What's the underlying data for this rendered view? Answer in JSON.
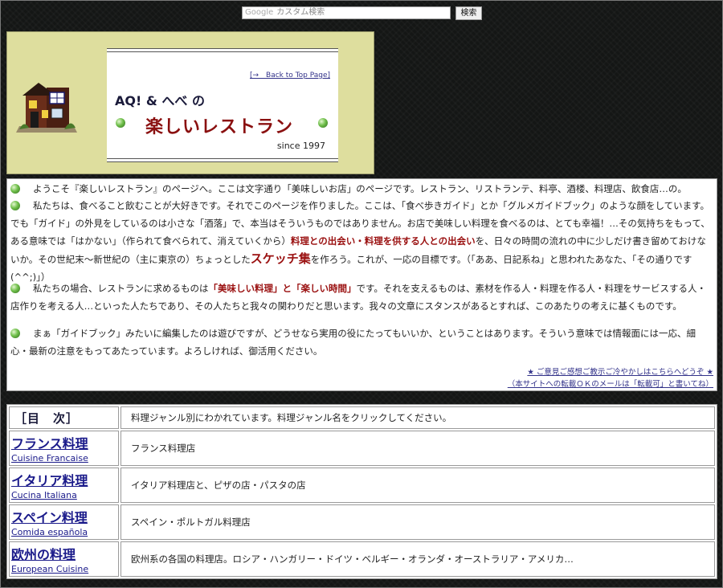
{
  "search": {
    "placeholder_brand": "Google",
    "placeholder": "カスタム検索",
    "button_label": "検索"
  },
  "header": {
    "back_link": "[→　Back to Top Page]",
    "brand": "AQ! & へべ の",
    "title": "楽しいレストラン",
    "since": "since 1997"
  },
  "intro": {
    "p1": "ようこそ『楽しいレストラン』のページへ。ここは文字通り「美味しいお店」のページです。レストラン、リストランテ、料亭、酒楼、料理店、飲食店…の。",
    "p2_a": "私たちは、食べること飲むことが大好きです。それでこのページを作りました。ここは、「食べ歩きガイド」とか「グルメガイドブック」のような顔をしています。でも「ガイド」の外見をしているのは小さな「酒落」で、本当はそういうものではありません。お店で美味しい料理を食べるのは、とても幸福！…その気持ちをもって、ある意味では「はかない」（作られて食べられて、消えていくから）",
    "p2_red": "料理との出会い・料理を供する人との出会い",
    "p2_b": "を、日々の時間の流れの中に少しだけ書き留めておけないか。その世紀末～新世紀の（主に東京の）ちょっとした",
    "p2_big": "スケッチ集",
    "p2_c": "を作ろう。これが、一応の目標です。（「ああ、日記系ね」と思われたあなた、「その通りです(^^;)」）",
    "p3_a": "私たちの場合、レストランに求めるものは",
    "p3_red": "「美味しい料理」と「楽しい時間」",
    "p3_b": "です。それを支えるものは、素材を作る人・料理を作る人・料理をサービスする人・店作りを考える人…といった人たちであり、その人たちと我々の関わりだと思います。我々の文章にスタンスがあるとすれば、このあたりの考えに基くものです。",
    "p4": "まぁ「ガイドブック」みたいに編集したのは遊びですが、どうせなら実用の役にたってもいいか、ということはあります。そういう意味では情報面には一応、細心・最新の注意をもってあたっています。よろしければ、御活用ください。",
    "contact_1": "★ ご意見ご感想ご教示ご冷やかしはこちらへどうぞ ★",
    "contact_2": "（本サイトへの転載ＯＫのメールは「転載可」と書いてね）"
  },
  "toc": {
    "header": "［目　次］",
    "header_desc": "料理ジャンル別にわかれています。料理ジャンル名をクリックしてください。",
    "rows": [
      {
        "name": "フランス料理",
        "sub": "Cuisine Francaise",
        "desc": "フランス料理店"
      },
      {
        "name": "イタリア料理",
        "sub": "Cucina Italiana",
        "desc": "イタリア料理店と、ピザの店・パスタの店"
      },
      {
        "name": "スペイン料理",
        "sub": "Comida española",
        "desc": "スペイン・ポルトガル料理店"
      },
      {
        "name": "欧州の料理",
        "sub": "European Cuisine",
        "desc": "欧州系の各国の料理店。ロシア・ハンガリー・ドイツ・ベルギー・オランダ・オーストラリア・アメリカ…"
      }
    ]
  },
  "colors": {
    "accent_red": "#9a1010",
    "link_blue": "#1a1a8a",
    "header_bg": "#dede9e"
  },
  "icons": [
    "house-illustration-icon",
    "green-orb-icon"
  ]
}
